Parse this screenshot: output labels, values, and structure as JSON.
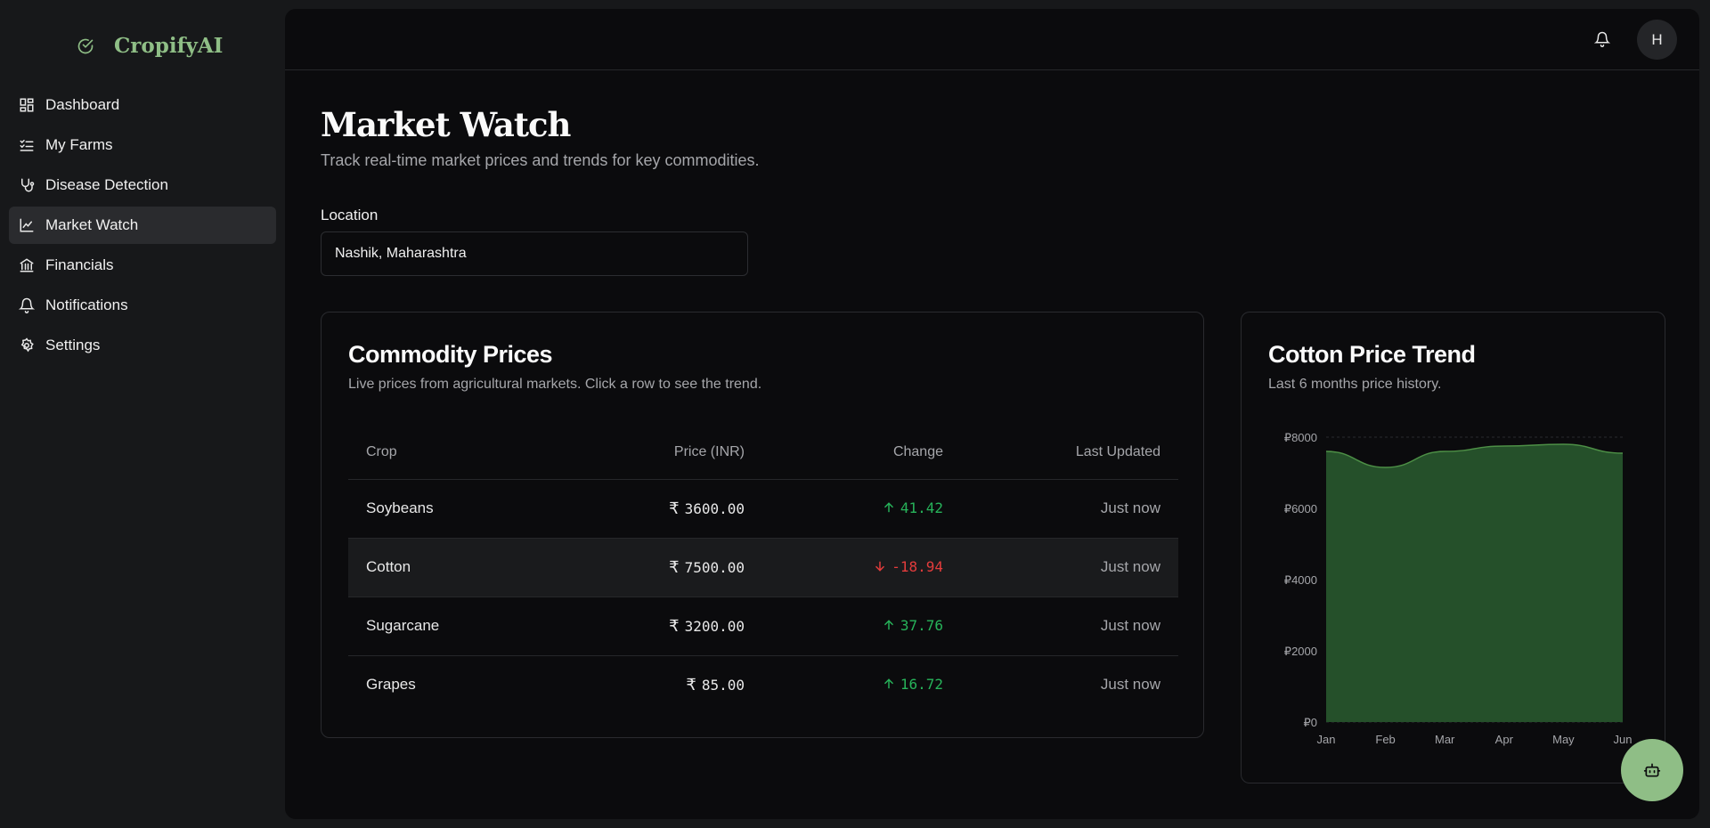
{
  "app": {
    "name": "CropifyAI",
    "brand_color": "#8fbe86"
  },
  "sidebar": {
    "items": [
      {
        "label": "Dashboard",
        "icon": "grid-icon"
      },
      {
        "label": "My Farms",
        "icon": "checklist-icon"
      },
      {
        "label": "Disease Detection",
        "icon": "stethoscope-icon"
      },
      {
        "label": "Market Watch",
        "icon": "chart-icon",
        "active": true
      },
      {
        "label": "Financials",
        "icon": "bank-icon"
      },
      {
        "label": "Notifications",
        "icon": "bell-icon"
      },
      {
        "label": "Settings",
        "icon": "gear-icon"
      }
    ]
  },
  "header": {
    "avatar_initial": "H"
  },
  "page": {
    "title": "Market Watch",
    "subtitle": "Track real-time market prices and trends for key commodities.",
    "location_label": "Location",
    "location_value": "Nashik, Maharashtra"
  },
  "prices_card": {
    "title": "Commodity Prices",
    "description": "Live prices from agricultural markets. Click a row to see the trend.",
    "columns": [
      "Crop",
      "Price (INR)",
      "Change",
      "Last Updated"
    ],
    "rows": [
      {
        "crop": "Soybeans",
        "price": "3600.00",
        "change": "41.42",
        "direction": "up",
        "updated": "Just now"
      },
      {
        "crop": "Cotton",
        "price": "7500.00",
        "change": "-18.94",
        "direction": "down",
        "updated": "Just now",
        "selected": true
      },
      {
        "crop": "Sugarcane",
        "price": "3200.00",
        "change": "37.76",
        "direction": "up",
        "updated": "Just now"
      },
      {
        "crop": "Grapes",
        "price": "85.00",
        "change": "16.72",
        "direction": "up",
        "updated": "Just now"
      }
    ],
    "currency_symbol": "₹"
  },
  "chart_card": {
    "title": "Cotton Price Trend",
    "description": "Last 6 months price history."
  },
  "chart_data": {
    "type": "area",
    "categories": [
      "Jan",
      "Feb",
      "Mar",
      "Apr",
      "May",
      "Jun"
    ],
    "series": [
      {
        "values": [
          7600,
          7150,
          7600,
          7750,
          7800,
          7550
        ]
      }
    ],
    "ylim": [
      0,
      8000
    ],
    "yticks": [
      0,
      2000,
      4000,
      6000,
      8000
    ],
    "ytick_labels": [
      "₽0",
      "₽2000",
      "₽4000",
      "₽6000",
      "₽8000"
    ],
    "grid": true,
    "fill_color": "#25502a",
    "line_color": "#4d8f46"
  }
}
